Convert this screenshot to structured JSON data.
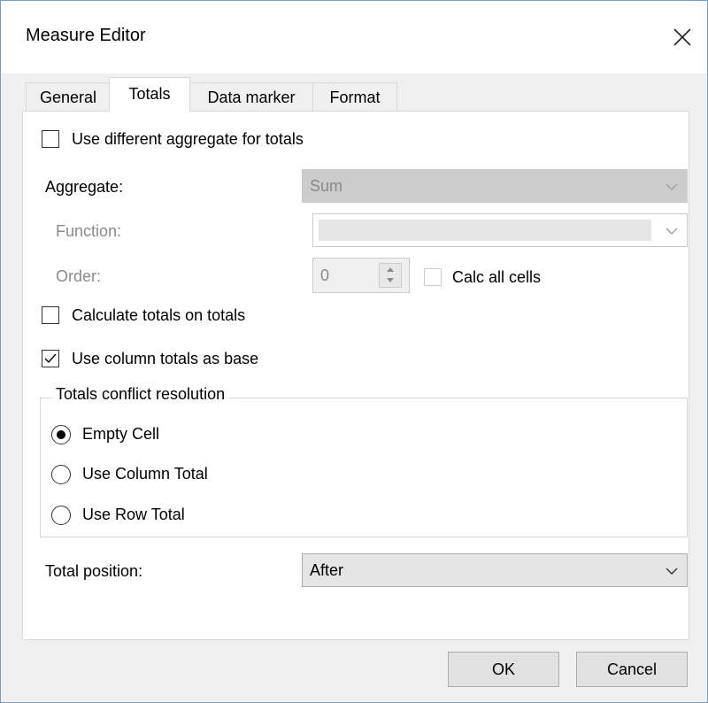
{
  "window": {
    "title": "Measure Editor",
    "close_glyph": "✕"
  },
  "tabs": [
    {
      "label": "General",
      "active": false
    },
    {
      "label": "Totals",
      "active": true
    },
    {
      "label": "Data marker",
      "active": false
    },
    {
      "label": "Format",
      "active": false
    }
  ],
  "totals": {
    "use_different_aggregate": {
      "label": "Use different aggregate for totals",
      "checked": false
    },
    "aggregate": {
      "label": "Aggregate:",
      "value": "Sum",
      "enabled": false
    },
    "function": {
      "label": "Function:",
      "value": "",
      "enabled": false
    },
    "order": {
      "label": "Order:",
      "value": "0",
      "enabled": false
    },
    "calc_all_cells": {
      "label": "Calc all cells",
      "checked": false,
      "enabled": false
    },
    "calculate_totals_on_totals": {
      "label": "Calculate totals on totals",
      "checked": false
    },
    "use_column_totals_as_base": {
      "label": "Use column totals as base",
      "checked": true
    },
    "conflict_resolution": {
      "title": "Totals conflict resolution",
      "options": [
        {
          "label": "Empty Cell",
          "selected": true
        },
        {
          "label": "Use Column Total",
          "selected": false
        },
        {
          "label": "Use Row Total",
          "selected": false
        }
      ]
    },
    "total_position": {
      "label": "Total position:",
      "value": "After"
    }
  },
  "buttons": {
    "ok": "OK",
    "cancel": "Cancel"
  },
  "icons": {
    "close": "close-icon",
    "dropdown": "chevron-down-icon",
    "spin_up": "arrow-up-icon",
    "spin_down": "arrow-down-icon",
    "check": "checkmark-icon"
  }
}
